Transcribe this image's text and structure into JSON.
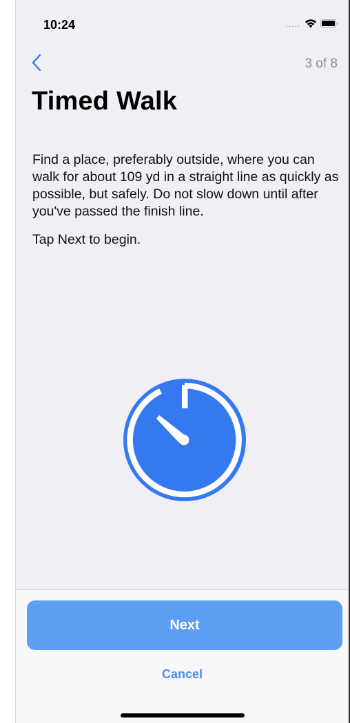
{
  "status_bar": {
    "time": "10:24",
    "signal_dots": ".....",
    "icons": [
      "wifi-icon",
      "battery-icon"
    ]
  },
  "nav": {
    "back_icon": "chevron-left-icon",
    "step_counter": "3 of 8"
  },
  "content": {
    "title": "Timed Walk",
    "description": "Find a place, preferably outside, where you can walk for about 109 yd in a straight line as quickly as possible, but safely. Do not slow down until after you've passed the finish line.",
    "instruction": "Tap Next to begin.",
    "illustration_icon": "stopwatch-icon"
  },
  "footer": {
    "next_label": "Next",
    "cancel_label": "Cancel"
  },
  "colors": {
    "accent": "#3579f0",
    "next_button": "#5d9ef5",
    "cancel_text": "#4a8ff0",
    "background": "#f0eff5",
    "secondary_text": "#8e8e93"
  }
}
